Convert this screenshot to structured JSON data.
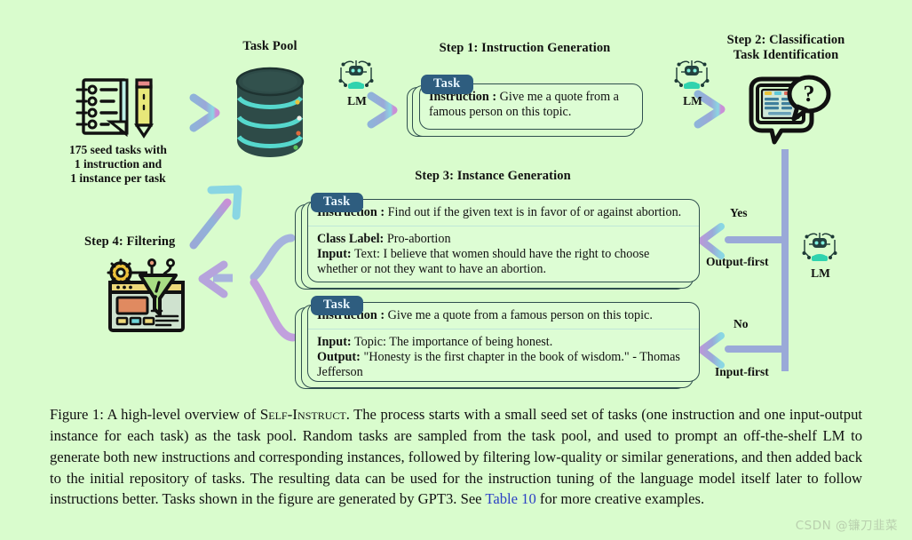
{
  "figure": {
    "background_color": "#d9fccd",
    "task_badge_color": "#2e5d7f",
    "arrow_color": "#9aa9d8",
    "link_color": "#2b3fc4"
  },
  "headings": {
    "task_pool": "Task Pool",
    "step1": "Step 1: Instruction Generation",
    "step2": "Step 2: Classification\nTask Identification",
    "step3": "Step 3: Instance Generation",
    "step4": "Step 4: Filtering"
  },
  "seed": {
    "caption": "175 seed tasks with\n1 instruction and\n1 instance per task",
    "icon": "notebook-pencil-icon"
  },
  "lm_labels": {
    "lm1": "LM",
    "lm2": "LM",
    "lm3": "LM"
  },
  "branch_labels": {
    "yes": "Yes",
    "output_first": "Output-first",
    "no": "No",
    "input_first": "Input-first"
  },
  "cards": {
    "step1": {
      "badge": "Task",
      "sections": [
        {
          "label": "Instruction :",
          "text": " Give me a quote from a famous person on this topic."
        }
      ]
    },
    "step3_classification": {
      "badge": "Task",
      "sections": [
        {
          "label": "Instruction :",
          "text": " Find out if the given text is in favor of or against abortion."
        },
        {
          "label": "Class Label:",
          "text": " Pro-abortion",
          "label2": "Input:",
          "text2": " Text: I believe that women should have the right to choose whether or not they want to have an abortion."
        }
      ]
    },
    "step3_generation": {
      "badge": "Task",
      "sections": [
        {
          "label": "Instruction :",
          "text": " Give me a quote from a famous person on this topic."
        },
        {
          "label": "Input:",
          "text": " Topic: The importance of being honest.",
          "label2": "Output:",
          "text2": " \"Honesty is the first chapter in the book of wisdom.\" - Thomas Jefferson"
        }
      ]
    }
  },
  "caption": {
    "prefix": "Figure 1: A high-level overview of ",
    "smallcaps": "Self-Instruct",
    "body1": ". The process starts with a small seed set of tasks (one instruction and one input-output instance for each task) as the task pool. Random tasks are sampled from the task pool, and used to prompt an off-the-shelf LM to generate both new instructions and corresponding instances, followed by filtering low-quality or similar generations, and then added back to the initial repository of tasks. The resulting data can be used for the instruction tuning of the language model itself later to follow instructions better. Tasks shown in the figure are generated by GPT3. See ",
    "link": "Table 10",
    "body2": " for more creative examples."
  },
  "watermark": "CSDN @镰刀韭菜"
}
